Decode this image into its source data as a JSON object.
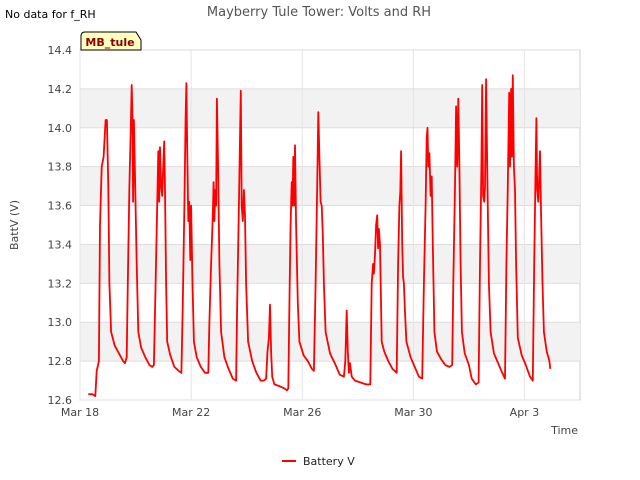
{
  "no_data_note": "No data for f_RH",
  "station_tag": "MB_tule",
  "chart_data": {
    "type": "line",
    "title": "Mayberry Tule Tower: Volts and RH",
    "xlabel": "Time",
    "ylabel": "BattV (V)",
    "ylim": [
      12.6,
      14.4
    ],
    "xlim_days": [
      0,
      18
    ],
    "x_unit": "days after Mar 18",
    "y_ticks": [
      12.6,
      12.8,
      13.0,
      13.2,
      13.4,
      13.6,
      13.8,
      14.0,
      14.2,
      14.4
    ],
    "x_ticks": [
      {
        "day": 0,
        "label": "Mar 18"
      },
      {
        "day": 4,
        "label": "Mar 22"
      },
      {
        "day": 8,
        "label": "Mar 26"
      },
      {
        "day": 12,
        "label": "Mar 30"
      },
      {
        "day": 16,
        "label": "Apr 3"
      }
    ],
    "grid": true,
    "legend_position": "bottom-center",
    "series": [
      {
        "name": "Battery V",
        "color": "#ff0000",
        "points": [
          [
            0.3,
            12.63
          ],
          [
            0.45,
            12.63
          ],
          [
            0.55,
            12.62
          ],
          [
            0.6,
            12.75
          ],
          [
            0.68,
            12.8
          ],
          [
            0.72,
            13.5
          ],
          [
            0.78,
            13.8
          ],
          [
            0.85,
            13.85
          ],
          [
            0.92,
            14.04
          ],
          [
            0.97,
            14.04
          ],
          [
            1.02,
            13.7
          ],
          [
            1.06,
            13.2
          ],
          [
            1.12,
            12.95
          ],
          [
            1.25,
            12.88
          ],
          [
            1.4,
            12.84
          ],
          [
            1.55,
            12.8
          ],
          [
            1.62,
            12.79
          ],
          [
            1.68,
            12.82
          ],
          [
            1.72,
            13.2
          ],
          [
            1.78,
            13.7
          ],
          [
            1.83,
            14.0
          ],
          [
            1.86,
            14.22
          ],
          [
            1.89,
            14.05
          ],
          [
            1.91,
            13.62
          ],
          [
            1.94,
            14.04
          ],
          [
            1.98,
            13.75
          ],
          [
            2.04,
            13.3
          ],
          [
            2.1,
            12.95
          ],
          [
            2.2,
            12.87
          ],
          [
            2.35,
            12.82
          ],
          [
            2.5,
            12.78
          ],
          [
            2.6,
            12.77
          ],
          [
            2.66,
            12.78
          ],
          [
            2.72,
            13.2
          ],
          [
            2.78,
            13.6
          ],
          [
            2.82,
            13.88
          ],
          [
            2.85,
            13.62
          ],
          [
            2.88,
            13.9
          ],
          [
            2.92,
            13.7
          ],
          [
            2.96,
            13.65
          ],
          [
            2.99,
            13.78
          ],
          [
            3.03,
            13.93
          ],
          [
            3.06,
            13.68
          ],
          [
            3.1,
            13.2
          ],
          [
            3.14,
            12.9
          ],
          [
            3.25,
            12.83
          ],
          [
            3.4,
            12.77
          ],
          [
            3.55,
            12.75
          ],
          [
            3.65,
            12.74
          ],
          [
            3.7,
            13.1
          ],
          [
            3.76,
            13.6
          ],
          [
            3.8,
            14.05
          ],
          [
            3.83,
            14.23
          ],
          [
            3.86,
            13.9
          ],
          [
            3.9,
            13.52
          ],
          [
            3.93,
            13.62
          ],
          [
            3.97,
            13.32
          ],
          [
            4.0,
            13.6
          ],
          [
            4.05,
            13.2
          ],
          [
            4.1,
            12.9
          ],
          [
            4.2,
            12.82
          ],
          [
            4.35,
            12.77
          ],
          [
            4.5,
            12.74
          ],
          [
            4.62,
            12.74
          ],
          [
            4.66,
            13.0
          ],
          [
            4.72,
            13.3
          ],
          [
            4.78,
            13.55
          ],
          [
            4.81,
            13.72
          ],
          [
            4.84,
            13.52
          ],
          [
            4.87,
            13.68
          ],
          [
            4.9,
            13.6
          ],
          [
            4.93,
            14.15
          ],
          [
            4.97,
            13.8
          ],
          [
            5.02,
            13.3
          ],
          [
            5.08,
            12.95
          ],
          [
            5.2,
            12.82
          ],
          [
            5.35,
            12.76
          ],
          [
            5.5,
            12.71
          ],
          [
            5.62,
            12.7
          ],
          [
            5.66,
            13.1
          ],
          [
            5.72,
            13.6
          ],
          [
            5.76,
            13.95
          ],
          [
            5.79,
            14.19
          ],
          [
            5.82,
            13.6
          ],
          [
            5.86,
            13.52
          ],
          [
            5.9,
            13.68
          ],
          [
            5.94,
            13.55
          ],
          [
            5.98,
            13.2
          ],
          [
            6.05,
            12.9
          ],
          [
            6.2,
            12.8
          ],
          [
            6.35,
            12.74
          ],
          [
            6.5,
            12.7
          ],
          [
            6.62,
            12.7
          ],
          [
            6.7,
            12.71
          ],
          [
            6.75,
            12.85
          ],
          [
            6.8,
            12.92
          ],
          [
            6.84,
            13.09
          ],
          [
            6.88,
            12.85
          ],
          [
            6.92,
            12.72
          ],
          [
            7.0,
            12.68
          ],
          [
            7.2,
            12.67
          ],
          [
            7.35,
            12.66
          ],
          [
            7.45,
            12.65
          ],
          [
            7.5,
            12.66
          ],
          [
            7.55,
            13.2
          ],
          [
            7.58,
            13.5
          ],
          [
            7.62,
            13.72
          ],
          [
            7.65,
            13.6
          ],
          [
            7.68,
            13.85
          ],
          [
            7.71,
            13.6
          ],
          [
            7.74,
            13.91
          ],
          [
            7.78,
            13.5
          ],
          [
            7.84,
            13.1
          ],
          [
            7.9,
            12.9
          ],
          [
            8.05,
            12.83
          ],
          [
            8.2,
            12.8
          ],
          [
            8.35,
            12.76
          ],
          [
            8.42,
            12.75
          ],
          [
            8.48,
            13.2
          ],
          [
            8.54,
            13.7
          ],
          [
            8.58,
            14.08
          ],
          [
            8.62,
            13.85
          ],
          [
            8.66,
            13.62
          ],
          [
            8.7,
            13.6
          ],
          [
            8.74,
            13.45
          ],
          [
            8.78,
            13.2
          ],
          [
            8.84,
            12.95
          ],
          [
            9.0,
            12.84
          ],
          [
            9.2,
            12.78
          ],
          [
            9.35,
            12.73
          ],
          [
            9.5,
            12.72
          ],
          [
            9.55,
            12.8
          ],
          [
            9.6,
            13.06
          ],
          [
            9.64,
            12.85
          ],
          [
            9.68,
            12.74
          ],
          [
            9.72,
            12.79
          ],
          [
            9.78,
            12.72
          ],
          [
            9.9,
            12.7
          ],
          [
            10.1,
            12.69
          ],
          [
            10.3,
            12.68
          ],
          [
            10.45,
            12.68
          ],
          [
            10.5,
            13.2
          ],
          [
            10.55,
            13.3
          ],
          [
            10.58,
            13.25
          ],
          [
            10.62,
            13.35
          ],
          [
            10.66,
            13.5
          ],
          [
            10.7,
            13.55
          ],
          [
            10.73,
            13.38
          ],
          [
            10.76,
            13.48
          ],
          [
            10.8,
            13.4
          ],
          [
            10.86,
            12.9
          ],
          [
            10.95,
            12.85
          ],
          [
            11.1,
            12.8
          ],
          [
            11.25,
            12.76
          ],
          [
            11.4,
            12.74
          ],
          [
            11.45,
            13.3
          ],
          [
            11.5,
            13.6
          ],
          [
            11.53,
            13.67
          ],
          [
            11.56,
            13.88
          ],
          [
            11.6,
            13.4
          ],
          [
            11.63,
            13.23
          ],
          [
            11.66,
            13.2
          ],
          [
            11.7,
            13.05
          ],
          [
            11.75,
            12.9
          ],
          [
            11.9,
            12.82
          ],
          [
            12.05,
            12.77
          ],
          [
            12.2,
            12.72
          ],
          [
            12.32,
            12.71
          ],
          [
            12.38,
            13.2
          ],
          [
            12.44,
            13.6
          ],
          [
            12.48,
            13.95
          ],
          [
            12.51,
            14.0
          ],
          [
            12.54,
            13.8
          ],
          [
            12.58,
            13.87
          ],
          [
            12.62,
            13.65
          ],
          [
            12.66,
            13.75
          ],
          [
            12.7,
            13.4
          ],
          [
            12.76,
            12.95
          ],
          [
            12.85,
            12.85
          ],
          [
            13.0,
            12.81
          ],
          [
            13.15,
            12.78
          ],
          [
            13.3,
            12.77
          ],
          [
            13.4,
            12.78
          ],
          [
            13.44,
            13.2
          ],
          [
            13.5,
            13.7
          ],
          [
            13.54,
            14.11
          ],
          [
            13.58,
            13.8
          ],
          [
            13.62,
            14.15
          ],
          [
            13.66,
            13.8
          ],
          [
            13.7,
            13.3
          ],
          [
            13.75,
            12.95
          ],
          [
            13.85,
            12.84
          ],
          [
            14.0,
            12.78
          ],
          [
            14.1,
            12.71
          ],
          [
            14.25,
            12.68
          ],
          [
            14.35,
            12.69
          ],
          [
            14.4,
            13.3
          ],
          [
            14.45,
            13.8
          ],
          [
            14.48,
            14.22
          ],
          [
            14.51,
            13.65
          ],
          [
            14.55,
            13.62
          ],
          [
            14.58,
            13.7
          ],
          [
            14.62,
            14.25
          ],
          [
            14.66,
            13.8
          ],
          [
            14.72,
            13.2
          ],
          [
            14.78,
            12.95
          ],
          [
            14.9,
            12.84
          ],
          [
            15.05,
            12.79
          ],
          [
            15.2,
            12.74
          ],
          [
            15.3,
            12.71
          ],
          [
            15.35,
            13.3
          ],
          [
            15.4,
            13.7
          ],
          [
            15.45,
            14.18
          ],
          [
            15.48,
            13.8
          ],
          [
            15.52,
            14.2
          ],
          [
            15.55,
            13.85
          ],
          [
            15.58,
            14.27
          ],
          [
            15.62,
            13.8
          ],
          [
            15.66,
            13.68
          ],
          [
            15.7,
            13.3
          ],
          [
            15.76,
            12.92
          ],
          [
            15.9,
            12.83
          ],
          [
            16.05,
            12.78
          ],
          [
            16.2,
            12.72
          ],
          [
            16.3,
            12.7
          ],
          [
            16.35,
            13.3
          ],
          [
            16.4,
            13.8
          ],
          [
            16.43,
            14.05
          ],
          [
            16.46,
            13.68
          ],
          [
            16.5,
            13.62
          ],
          [
            16.53,
            13.75
          ],
          [
            16.56,
            13.88
          ],
          [
            16.6,
            13.55
          ],
          [
            16.65,
            13.2
          ],
          [
            16.7,
            12.95
          ],
          [
            16.8,
            12.85
          ],
          [
            16.9,
            12.8
          ],
          [
            16.93,
            12.76
          ]
        ]
      }
    ]
  }
}
